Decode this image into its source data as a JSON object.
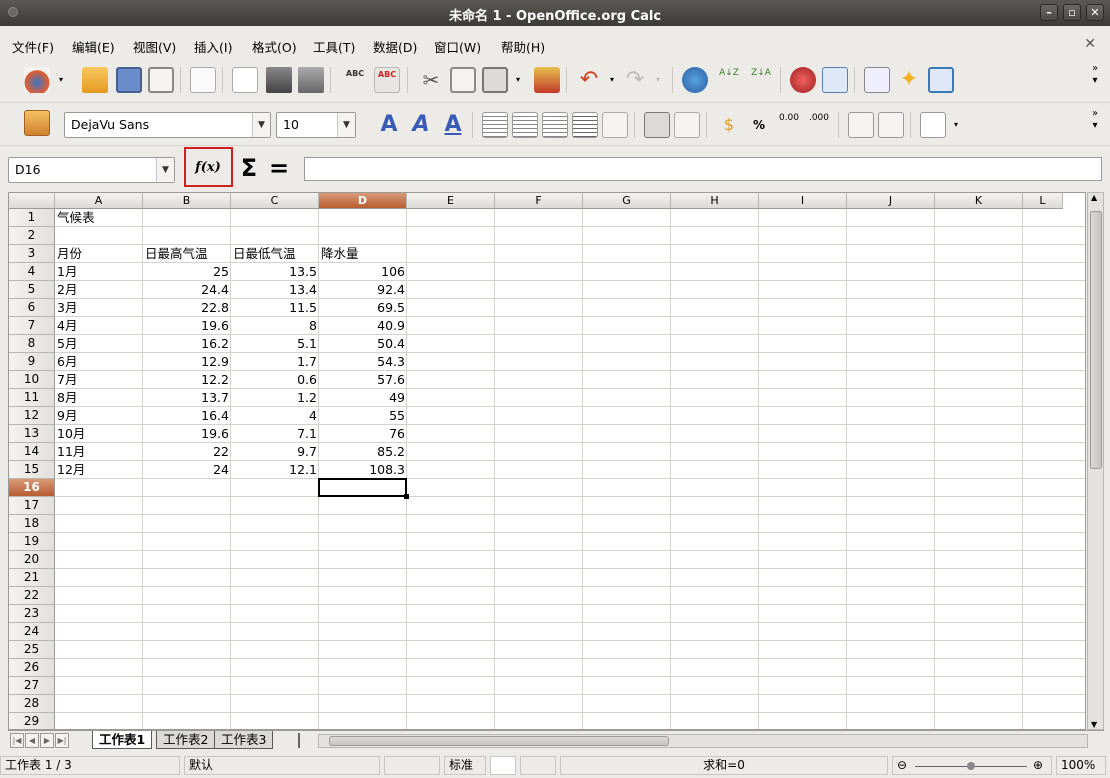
{
  "window": {
    "title": "未命名 1 - OpenOffice.org Calc"
  },
  "menu": [
    "文件(F)",
    "编辑(E)",
    "视图(V)",
    "插入(I)",
    "格式(O)",
    "工具(T)",
    "数据(D)",
    "窗口(W)",
    "帮助(H)"
  ],
  "format_toolbar": {
    "font_name": "DejaVu Sans",
    "font_size": "10"
  },
  "formula_bar": {
    "name_box": "D16",
    "fx_label": "f(x)",
    "sum_label": "Σ",
    "equals_label": "=",
    "input_value": ""
  },
  "sheet": {
    "columns": [
      "A",
      "B",
      "C",
      "D",
      "E",
      "F",
      "G",
      "H",
      "I",
      "J",
      "K",
      "L"
    ],
    "selected_column": "D",
    "selected_row": "16",
    "row_numbers": [
      "1",
      "2",
      "3",
      "4",
      "5",
      "6",
      "7",
      "8",
      "9",
      "10",
      "11",
      "12",
      "13",
      "14",
      "15",
      "16",
      "17",
      "18",
      "19",
      "20",
      "21",
      "22",
      "23",
      "24",
      "25",
      "26",
      "27",
      "28",
      "29"
    ],
    "title_cell": "气候表",
    "headers": [
      "月份",
      "日最高气温",
      "日最低气温",
      "降水量"
    ],
    "rows": [
      [
        "1月",
        "25",
        "13.5",
        "106"
      ],
      [
        "2月",
        "24.4",
        "13.4",
        "92.4"
      ],
      [
        "3月",
        "22.8",
        "11.5",
        "69.5"
      ],
      [
        "4月",
        "19.6",
        "8",
        "40.9"
      ],
      [
        "5月",
        "16.2",
        "5.1",
        "50.4"
      ],
      [
        "6月",
        "12.9",
        "1.7",
        "54.3"
      ],
      [
        "7月",
        "12.2",
        "0.6",
        "57.6"
      ],
      [
        "8月",
        "13.7",
        "1.2",
        "49"
      ],
      [
        "9月",
        "16.4",
        "4",
        "55"
      ],
      [
        "10月",
        "19.6",
        "7.1",
        "76"
      ],
      [
        "11月",
        "22",
        "9.7",
        "85.2"
      ],
      [
        "12月",
        "24",
        "12.1",
        "108.3"
      ]
    ]
  },
  "sheet_tabs": [
    "工作表1",
    "工作表2",
    "工作表3"
  ],
  "active_tab": "工作表1",
  "status": {
    "sheet_pos": "工作表 1 / 3",
    "page_style": "默认",
    "mode": "标准",
    "sum": "求和=0",
    "zoom": "100%"
  },
  "colors": {
    "selected_header": "#b85c30",
    "highlight_box": "#cc2222"
  }
}
